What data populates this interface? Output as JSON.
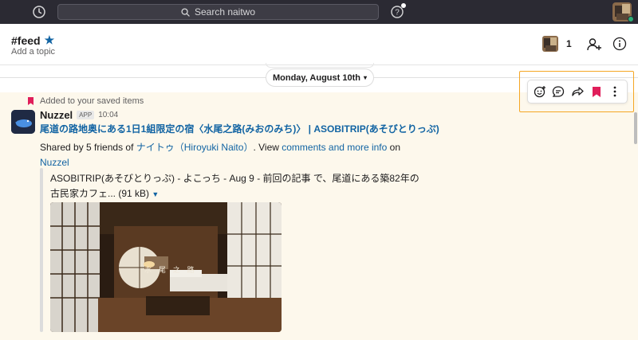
{
  "topbar": {
    "search_placeholder": "Search naitwo",
    "icons": [
      "history-icon",
      "search-icon",
      "help-icon",
      "user-avatar"
    ],
    "presence_color": "#2bac76"
  },
  "channel": {
    "name": "#feed",
    "topic": "Add a topic",
    "member_count": "1",
    "star_color": "#1264a3"
  },
  "date_divider": {
    "label": "Monday, August 10th"
  },
  "message": {
    "saved_label": "Added to your saved items",
    "sender": "Nuzzel",
    "app_badge": "APP",
    "time": "10:04",
    "title_link": "尾道の路地奥にある1日1組限定の宿〈水尾之路(みおのみち)〉 | ASOBITRIP(あそびとりっぷ)",
    "shared_prefix": "Shared by 5 friends of ",
    "shared_user_link": "ナイトゥ（Hiroyuki Naito）",
    "shared_mid": ". View ",
    "comments_link": "comments and more info",
    "shared_on": " on",
    "nuzzel_link": "Nuzzel",
    "attachment_text": "ASOBITRIP(あそびとりっぷ) - よこっち - Aug 9 - 前回の記事 で、尾道にある築82年の古民家カフェ... (91 kB)",
    "image_overlay_text": "水 尾 之 路"
  },
  "actions": {
    "icons": [
      "add-reaction-icon",
      "reply-thread-icon",
      "share-icon",
      "bookmark-icon",
      "more-icon"
    ],
    "bookmark_color": "#e01e5a",
    "highlight_color": "#f5a623"
  }
}
